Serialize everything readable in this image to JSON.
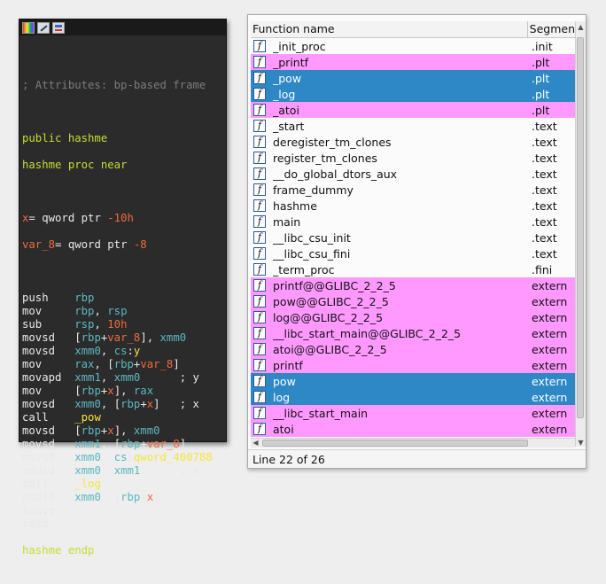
{
  "colors": {
    "asm_background": "#2b2b2b",
    "comment": "#7c7c7c",
    "label": "#c8dc32",
    "variable": "#f06b3a",
    "register": "#5bb8c0",
    "highlight": "#f5e53c",
    "row_pink": "#ff99ff",
    "row_blue": "#2e88c6"
  },
  "asm": {
    "toolbar_icons": [
      "palette-icon",
      "edit-icon",
      "graph-icon"
    ],
    "comment": "; Attributes: bp-based frame",
    "public_line": "public hashme",
    "proc_line": "hashme proc near",
    "vars": [
      {
        "name": "x",
        "decl": "= qword ptr ",
        "offset": "-10h"
      },
      {
        "name": "var_8",
        "decl": "= qword ptr ",
        "offset": "-8"
      }
    ],
    "endp_line": "hashme endp"
  },
  "functions": {
    "columns": {
      "name": "Function name",
      "segment": "Segmen"
    },
    "status": "Line 22 of 26"
  }
}
